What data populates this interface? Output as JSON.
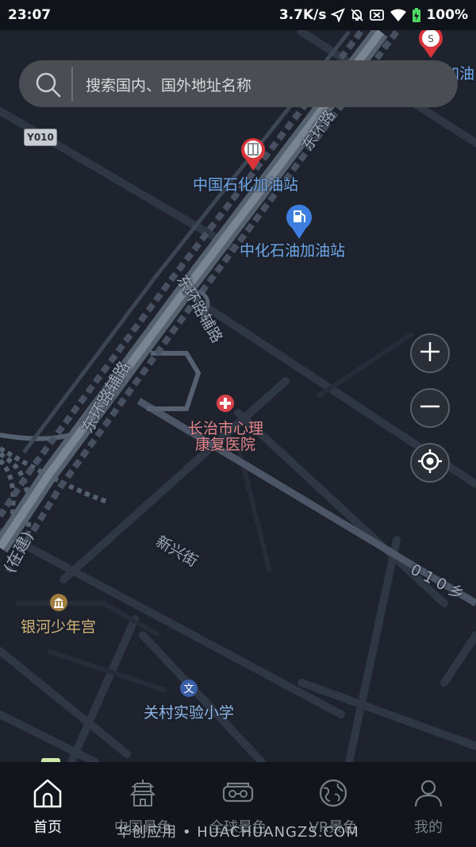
{
  "status_bar": {
    "time": "23:07",
    "net_speed": "3.7K/s",
    "battery": "100%",
    "icons": [
      "location-arrow-icon",
      "bell-off-icon",
      "no-sim-icon",
      "wifi-icon",
      "battery-charging-icon"
    ]
  },
  "search": {
    "placeholder": "搜索国内、国外地址名称",
    "icon": "search-icon"
  },
  "map": {
    "road_badge": "Y010",
    "roads": {
      "dong_huan_lu_top": "东环路",
      "dong_huan_lu_fu_lu_mid": "东环路辅路",
      "dong_huan_lu_fu_lu_left": "东环路辅路",
      "xin_xing_jie": "新兴街",
      "zai_jian": "(在建)",
      "xiang_010": "010乡"
    },
    "pois": {
      "sinopec_top_right": "加油",
      "sinopec": "中国石化加油站",
      "sinochem": "中化石油加油站",
      "hospital_line1": "长治市心理",
      "hospital_line2": "康复医院",
      "youth_palace": "银河少年宫",
      "school": "关村实验小学"
    },
    "controls": {
      "zoom_in": "zoom-in-icon",
      "zoom_out": "zoom-out-icon",
      "locate": "locate-icon"
    }
  },
  "bottom_nav": {
    "items": [
      {
        "label": "首页",
        "icon": "home-icon",
        "active": true
      },
      {
        "label": "中国景色",
        "icon": "pagoda-icon",
        "active": false
      },
      {
        "label": "全球景色",
        "icon": "vr-glasses-icon",
        "active": false
      },
      {
        "label": "VR景色",
        "icon": "globe-icon",
        "active": false
      },
      {
        "label": "我的",
        "icon": "person-icon",
        "active": false
      }
    ]
  },
  "watermark": "华创应用 • HUACHUANGZS.COM",
  "colors": {
    "map_bg": "#1e232d",
    "road": "#3a4252",
    "highway": "#6b7380",
    "poi_blue": "#6fa6e8",
    "poi_red": "#e3858a",
    "nav_bg": "#12161c"
  }
}
